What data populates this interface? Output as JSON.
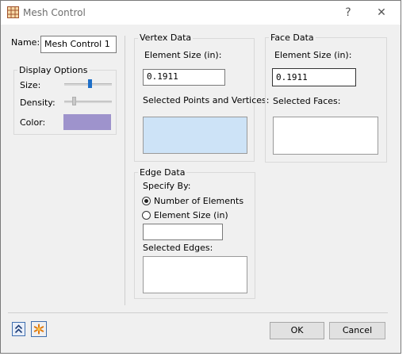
{
  "window": {
    "title": "Mesh Control",
    "help_label": "?",
    "close_label": "✕"
  },
  "name_field": {
    "label": "Name:",
    "value": "Mesh Control 1"
  },
  "display_options": {
    "title": "Display Options",
    "size_label": "Size:",
    "size_level": 0.55,
    "density_label": "Density:",
    "density_level": 0.18,
    "color_label": "Color:",
    "color_value": "#9e93cc"
  },
  "vertex_data": {
    "title": "Vertex Data",
    "element_size_label": "Element Size (in):",
    "element_size_value": "0.1911",
    "selected_label": "Selected Points and Vertices:",
    "selected_bg": "#cde3f7"
  },
  "face_data": {
    "title": "Face Data",
    "element_size_label": "Element Size (in):",
    "element_size_value": "0.1911",
    "selected_label": "Selected Faces:"
  },
  "edge_data": {
    "title": "Edge Data",
    "specify_by_label": "Specify By:",
    "option_elements": "Number of Elements",
    "option_size": "Element Size (in)",
    "selected_option": "Number of Elements",
    "value": "",
    "selected_label": "Selected Edges:"
  },
  "footer": {
    "ok_label": "OK",
    "cancel_label": "Cancel",
    "expand_icon": "double-chevron-up-icon",
    "reset_icon": "asterisk-icon"
  }
}
